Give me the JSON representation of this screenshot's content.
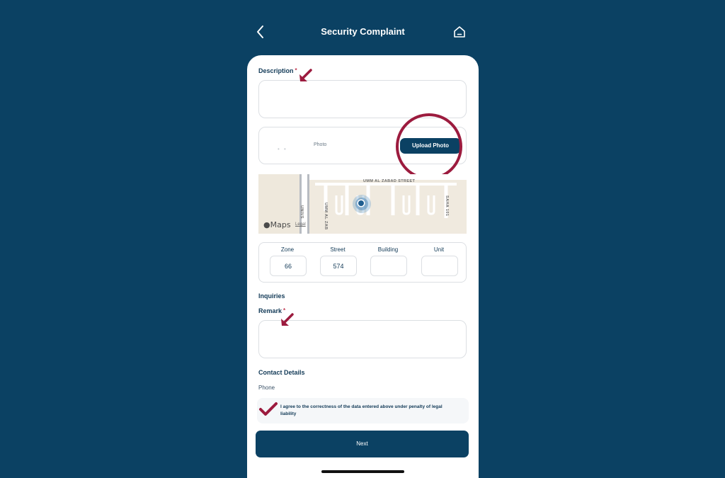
{
  "header": {
    "title": "Security Complaint"
  },
  "form": {
    "description_label": "Description",
    "required_mark": "*",
    "photo": {
      "placeholder": "Photo",
      "upload_label": "Upload Photo"
    },
    "map": {
      "brand": "Maps",
      "legal": "Legal",
      "street_top": "UMM AL ZABAD STREET",
      "street_left": "UNIVS",
      "street_mid": "UMM AL ZAB",
      "street_right": "SAHA 101"
    },
    "address": {
      "zone_label": "Zone",
      "zone_value": "66",
      "street_label": "Street",
      "street_value": "574",
      "building_label": "Building",
      "building_value": "",
      "unit_label": "Unit",
      "unit_value": ""
    },
    "inquiries_heading": "Inquiries",
    "remark_label": "Remark",
    "contact_heading": "Contact Details",
    "phone_label": "Phone",
    "agree_text": "I agree to the correctness of the data entered above under penalty of legal liability",
    "next_label": "Next"
  },
  "colors": {
    "background": "#0b4163",
    "primary": "#0b4163",
    "annotation": "#9c1b3e",
    "required": "#c23a52"
  }
}
